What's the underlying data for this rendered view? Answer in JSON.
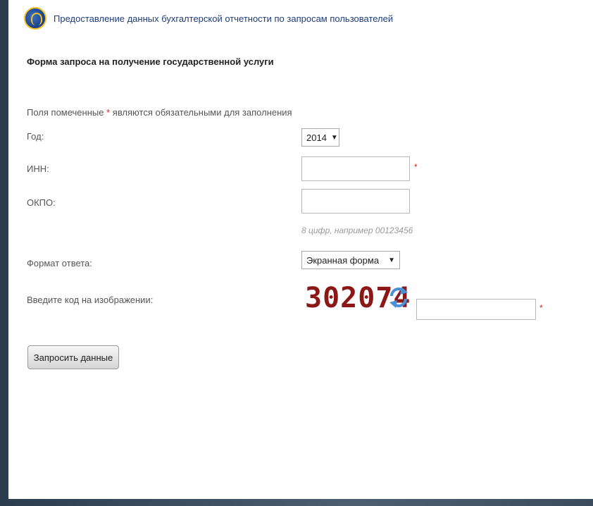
{
  "header": {
    "logo": "headset-logo-icon",
    "title": "Предоставление данных бухгалтерской отчетности по запросам пользователей"
  },
  "form": {
    "title": "Форма запроса на получение государственной услуги",
    "required_note_before": "Поля помеченные",
    "required_mark": "*",
    "required_note_after": "являются обязательными для заполнения",
    "year": {
      "label": "Год:",
      "value": "2014"
    },
    "inn": {
      "label": "ИНН:",
      "value": ""
    },
    "okpo": {
      "label": "ОКПО:",
      "value": "",
      "hint": "8 цифр, например 00123456"
    },
    "format": {
      "label": "Формат ответа:",
      "value": "Экранная форма"
    },
    "captcha": {
      "label": "Введите код на изображении:",
      "code": "302074",
      "value": ""
    },
    "submit_label": "Запросить данные"
  },
  "colors": {
    "required": "#e02020",
    "captcha": "#8b1717",
    "refresh": "#4a90d6"
  }
}
